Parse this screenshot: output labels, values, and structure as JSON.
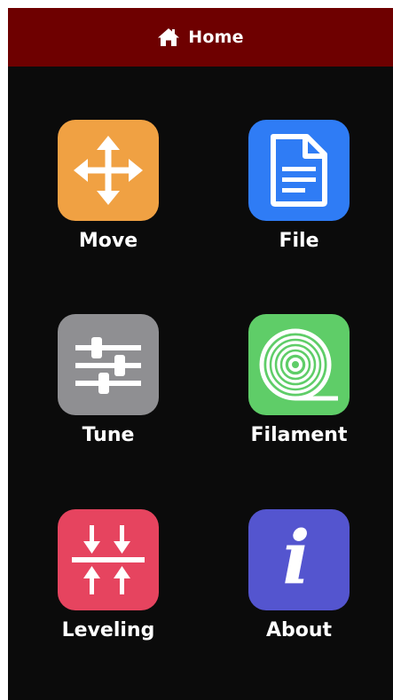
{
  "header": {
    "title": "Home",
    "icon": "home-icon",
    "background_color": "#6e0000"
  },
  "menu": {
    "items": [
      {
        "id": "move",
        "label": "Move",
        "icon": "move-arrows-icon",
        "color": "#f0a143"
      },
      {
        "id": "file",
        "label": "File",
        "icon": "document-icon",
        "color": "#2f7cf5"
      },
      {
        "id": "tune",
        "label": "Tune",
        "icon": "sliders-icon",
        "color": "#8f8f92"
      },
      {
        "id": "filament",
        "label": "Filament",
        "icon": "filament-spool-icon",
        "color": "#5fcd68"
      },
      {
        "id": "leveling",
        "label": "Leveling",
        "icon": "leveling-icon",
        "color": "#e6445f"
      },
      {
        "id": "about",
        "label": "About",
        "icon": "info-icon",
        "color": "#5455cf",
        "glyph": "i"
      }
    ]
  },
  "theme": {
    "screen_background": "#0b0b0b",
    "text_color": "#ffffff"
  }
}
